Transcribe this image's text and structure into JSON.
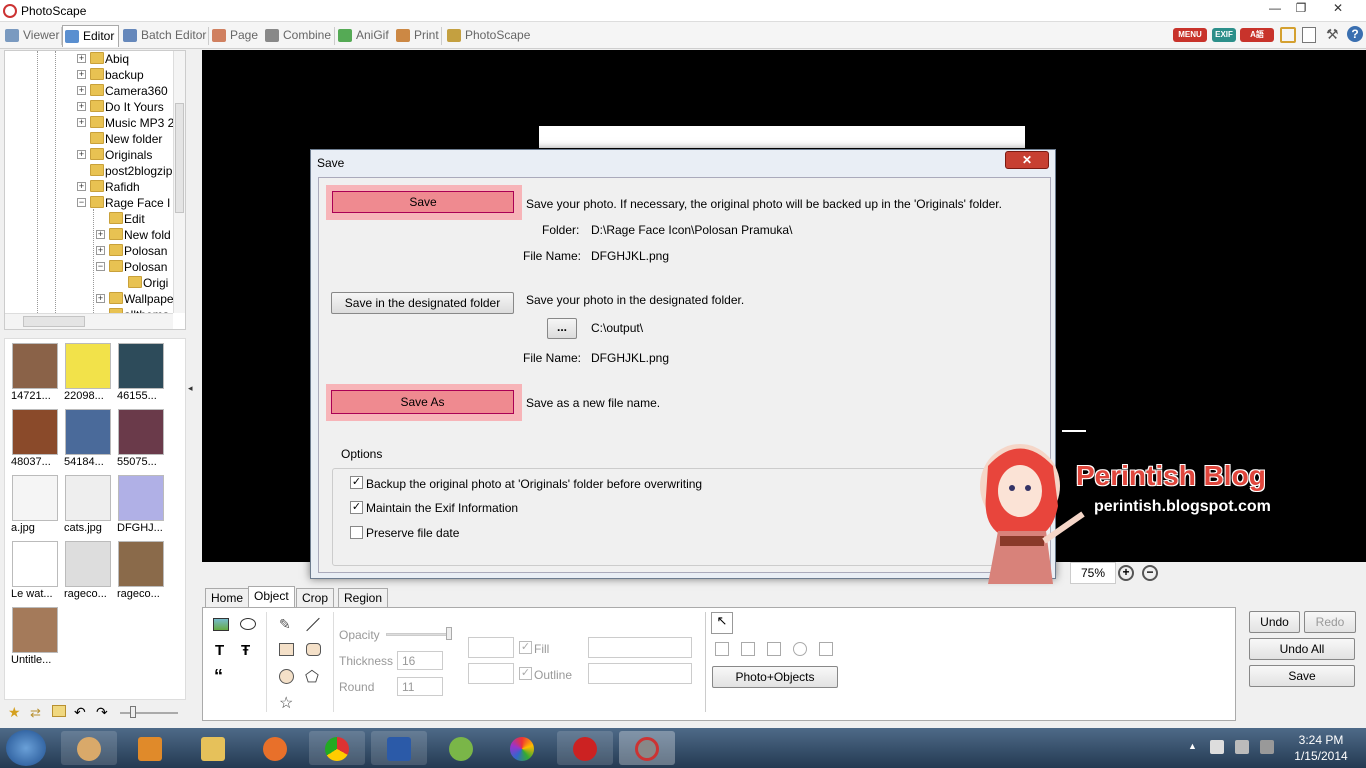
{
  "window": {
    "title": "PhotoScape",
    "min": "—",
    "max": "❐",
    "close": "✕"
  },
  "tabs": [
    {
      "label": "Viewer",
      "color": "#7a9ac0"
    },
    {
      "label": "Editor",
      "color": "#5a8fd0"
    },
    {
      "label": "Batch Editor",
      "color": "#6688bb"
    },
    {
      "label": "Page",
      "color": "#d08060"
    },
    {
      "label": "Combine",
      "color": "#888"
    },
    {
      "label": "AniGif",
      "color": "#55aa55"
    },
    {
      "label": "Print",
      "color": "#cc8844"
    },
    {
      "label": "PhotoScape",
      "color": "#c4a040"
    }
  ],
  "top_icons": {
    "menu": "MENU",
    "exif": "EXIF",
    "lang": "A語"
  },
  "tree": [
    {
      "label": "Abiq",
      "sign": "+",
      "level": 0
    },
    {
      "label": "backup",
      "sign": "+",
      "level": 0
    },
    {
      "label": "Camera360",
      "sign": "+",
      "level": 0
    },
    {
      "label": "Do It Yours",
      "sign": "+",
      "level": 0
    },
    {
      "label": "Music MP3 2",
      "sign": "+",
      "level": 0
    },
    {
      "label": "New folder",
      "sign": "",
      "level": 0
    },
    {
      "label": "Originals",
      "sign": "+",
      "level": 0
    },
    {
      "label": "post2blogzip",
      "sign": "",
      "level": 0
    },
    {
      "label": "Rafidh",
      "sign": "+",
      "level": 0
    },
    {
      "label": "Rage Face I",
      "sign": "−",
      "level": 0
    },
    {
      "label": "Edit",
      "sign": "",
      "level": 1
    },
    {
      "label": "New fold",
      "sign": "+",
      "level": 1
    },
    {
      "label": "Polosan",
      "sign": "+",
      "level": 1
    },
    {
      "label": "Polosan",
      "sign": "−",
      "level": 1
    },
    {
      "label": "Origi",
      "sign": "",
      "level": 2
    },
    {
      "label": "Wallpape",
      "sign": "+",
      "level": 1
    },
    {
      "label": "allthema",
      "sign": "",
      "level": 1
    }
  ],
  "thumbs": [
    {
      "cap": "14721...",
      "bg": "#8a6248"
    },
    {
      "cap": "22098...",
      "bg": "#f2e24a"
    },
    {
      "cap": "46155...",
      "bg": "#2d4b5a"
    },
    {
      "cap": "48037...",
      "bg": "#8a4a2a"
    },
    {
      "cap": "54184...",
      "bg": "#4a6a9a"
    },
    {
      "cap": "55075...",
      "bg": "#6a3a4a"
    },
    {
      "cap": "a.jpg",
      "bg": "#f5f5f5"
    },
    {
      "cap": "cats.jpg",
      "bg": "#eeeeee"
    },
    {
      "cap": "DFGHJ...",
      "bg": "#b0b0e6"
    },
    {
      "cap": "Le wat...",
      "bg": "#ffffff"
    },
    {
      "cap": "rageco...",
      "bg": "#dddddd"
    },
    {
      "cap": "rageco...",
      "bg": "#8a6a4a"
    },
    {
      "cap": "Untitle...",
      "bg": "#a47a5a"
    }
  ],
  "dialog": {
    "title": "Save",
    "close": "✕",
    "save_btn": "Save",
    "save_desc": "Save your photo. If necessary, the original photo will be backed up in the 'Originals' folder.",
    "folder_label": "Folder:",
    "folder_value": "D:\\Rage Face Icon\\Polosan Pramuka\\",
    "filename_label": "File Name:",
    "filename_value": "DFGHJKL.png",
    "designated_btn": "Save in the designated folder",
    "designated_desc": "Save your photo in the designated folder.",
    "browse_btn": "...",
    "output_folder": "C:\\output\\",
    "filename_label2": "File Name:",
    "filename_value2": "DFGHJKL.png",
    "saveas_btn": "Save As",
    "saveas_desc": "Save as a new file name.",
    "options_title": "Options",
    "opt1": "Backup the original photo at 'Originals' folder before overwriting",
    "opt2": "Maintain the Exif Information",
    "opt3": "Preserve file date"
  },
  "watermark": {
    "title": "Perintish Blog",
    "url": "perintish.blogspot.com"
  },
  "zoom": {
    "value": "75%"
  },
  "bottom_tabs": [
    "Home",
    "Object",
    "Crop",
    "Region"
  ],
  "object_panel": {
    "opacity": "Opacity",
    "thickness": "Thickness",
    "thickness_val": "16",
    "round": "Round",
    "round_val": "11",
    "fill": "Fill",
    "outline": "Outline",
    "photo_objects": "Photo+Objects"
  },
  "right_buttons": {
    "undo": "Undo",
    "redo": "Redo",
    "undo_all": "Undo All",
    "save": "Save"
  },
  "tray": {
    "time": "3:24 PM",
    "date": "1/15/2014"
  }
}
